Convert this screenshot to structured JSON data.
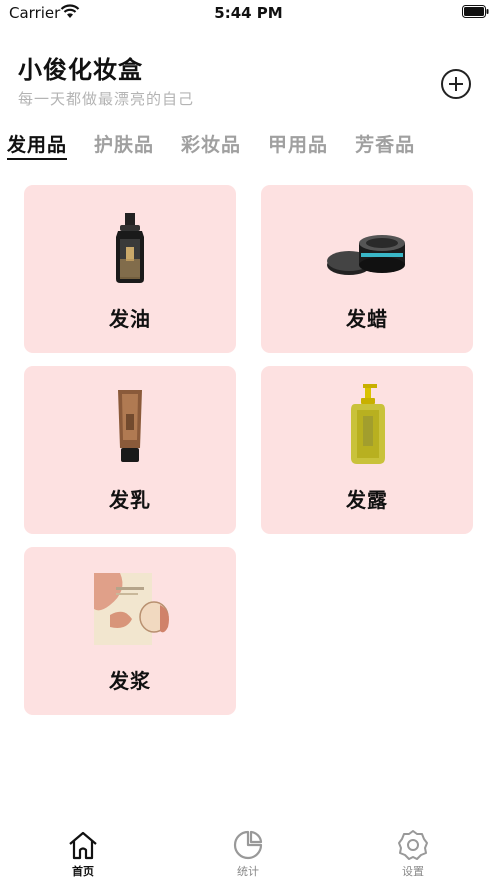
{
  "status_bar": {
    "carrier": "Carrier",
    "time": "5:44 PM"
  },
  "header": {
    "title": "小俊化妆盒",
    "subtitle": "每一天都做最漂亮的自己",
    "add_icon": "plus-circle-icon"
  },
  "tabs": [
    {
      "label": "发用品",
      "active": true
    },
    {
      "label": "护肤品",
      "active": false
    },
    {
      "label": "彩妆品",
      "active": false
    },
    {
      "label": "甲用品",
      "active": false
    },
    {
      "label": "芳香品",
      "active": false
    }
  ],
  "products": [
    {
      "label": "发油",
      "image": "hair-oil-bottle-icon"
    },
    {
      "label": "发蜡",
      "image": "hair-wax-jar-icon"
    },
    {
      "label": "发乳",
      "image": "hair-cream-tube-icon"
    },
    {
      "label": "发露",
      "image": "hair-lotion-pump-icon"
    },
    {
      "label": "发浆",
      "image": "hair-mask-pack-icon"
    }
  ],
  "tabbar": [
    {
      "label": "首页",
      "icon": "home-icon",
      "active": true
    },
    {
      "label": "统计",
      "icon": "pie-chart-icon",
      "active": false
    },
    {
      "label": "设置",
      "icon": "settings-gear-icon",
      "active": false
    }
  ],
  "colors": {
    "card_bg": "#fde1e1",
    "subtitle": "#b4b4b4",
    "tab_inactive": "#a0a0a0",
    "accent": "#111111"
  }
}
